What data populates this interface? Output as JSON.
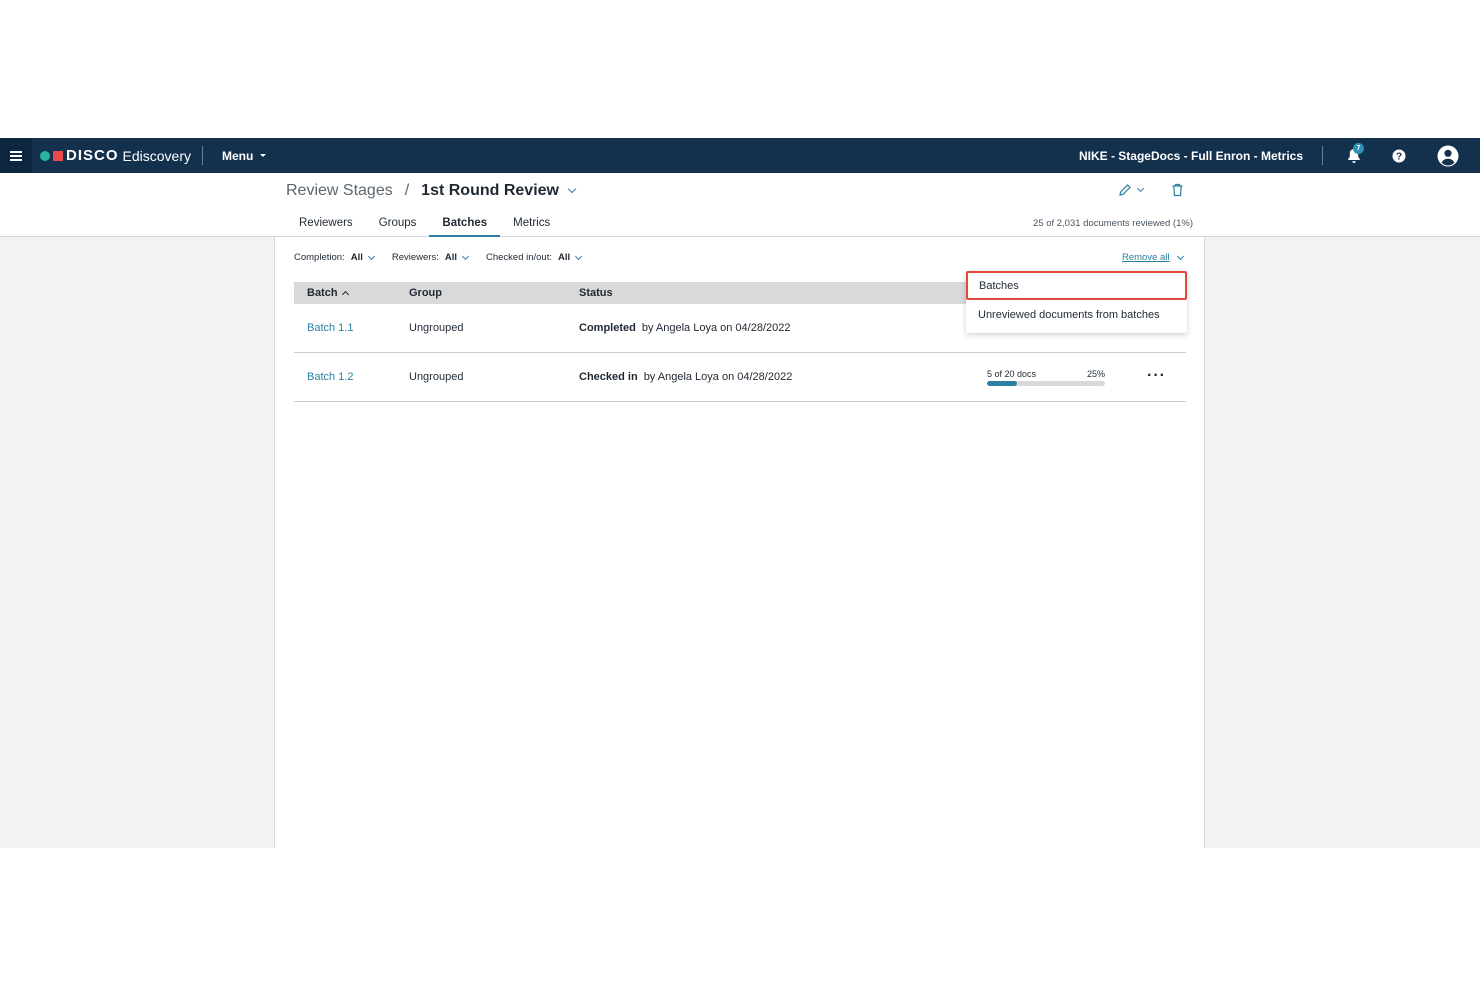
{
  "nav": {
    "brand": "DISCO",
    "brand_sub": "Ediscovery",
    "menu_label": "Menu",
    "case_name": "NIKE - StageDocs - Full Enron - Metrics",
    "notification_count": "7"
  },
  "header": {
    "breadcrumb_root": "Review Stages",
    "breadcrumb_sep": "/",
    "title": "1st Round Review",
    "doc_count": "25 of 2,031 documents reviewed (1%)",
    "tabs": [
      {
        "label": "Reviewers"
      },
      {
        "label": "Groups"
      },
      {
        "label": "Batches"
      },
      {
        "label": "Metrics"
      }
    ]
  },
  "filters": {
    "completion_label": "Completion:",
    "completion_value": "All",
    "reviewers_label": "Reviewers:",
    "reviewers_value": "All",
    "checked_label": "Checked in/out:",
    "checked_value": "All",
    "remove_all": "Remove all"
  },
  "table": {
    "headers": {
      "batch": "Batch",
      "group": "Group",
      "status": "Status"
    },
    "rows": [
      {
        "batch": "Batch 1.1",
        "group": "Ungrouped",
        "status_strong": "Completed",
        "status_rest": "by Angela Loya on 04/28/2022"
      },
      {
        "batch": "Batch 1.2",
        "group": "Ungrouped",
        "status_strong": "Checked in",
        "status_rest": "by Angela Loya on 04/28/2022",
        "progress_label": "5 of 20 docs",
        "progress_pct_label": "25%",
        "progress": 0.25,
        "more": "···"
      }
    ]
  },
  "dropdown": {
    "items": [
      {
        "label": "Batches"
      },
      {
        "label": "Unreviewed documents from batches"
      }
    ]
  },
  "colors": {
    "nav_bg": "#13304d",
    "accent": "#2a7fa3",
    "highlight": "#e04a3b"
  }
}
